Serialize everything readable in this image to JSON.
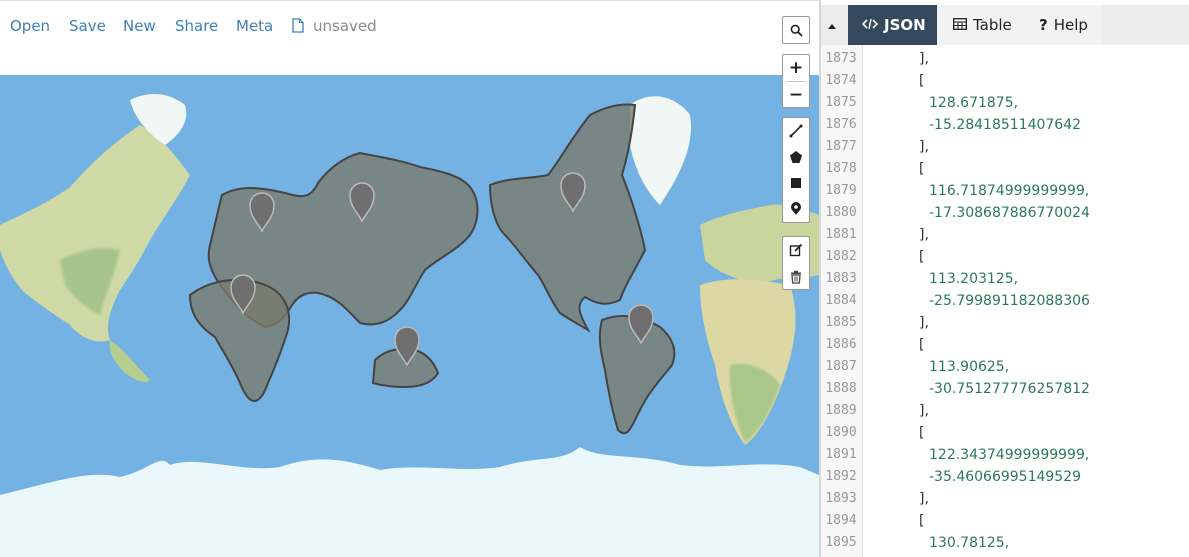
{
  "menu": {
    "items": [
      "Open",
      "Save",
      "New",
      "Share",
      "Meta"
    ],
    "file_status": "unsaved"
  },
  "map_controls": {
    "search_icon": "search-icon",
    "zoom_in": "+",
    "zoom_out": "−",
    "draw_tools": [
      "draw-line-icon",
      "draw-polygon-icon",
      "draw-rectangle-icon",
      "draw-marker-icon"
    ],
    "edit_tools": [
      "edit-layers-icon",
      "delete-layers-icon"
    ]
  },
  "panel": {
    "tabs": [
      {
        "label": "JSON",
        "icon": "code-icon",
        "active": true
      },
      {
        "label": "Table",
        "icon": "table-icon",
        "active": false
      },
      {
        "label": "Help",
        "icon": "help-icon",
        "active": false
      }
    ]
  },
  "editor": {
    "lines": [
      {
        "n": "1873",
        "text": "],",
        "type": "punct"
      },
      {
        "n": "1874",
        "text": "[",
        "type": "punct"
      },
      {
        "n": "1875",
        "text": "128.671875,",
        "type": "num"
      },
      {
        "n": "1876",
        "text": "-15.28418511407642",
        "type": "num"
      },
      {
        "n": "1877",
        "text": "],",
        "type": "punct"
      },
      {
        "n": "1878",
        "text": "[",
        "type": "punct"
      },
      {
        "n": "1879",
        "text": "116.71874999999999,",
        "type": "num"
      },
      {
        "n": "1880",
        "text": "-17.308687886770024",
        "type": "num"
      },
      {
        "n": "1881",
        "text": "],",
        "type": "punct"
      },
      {
        "n": "1882",
        "text": "[",
        "type": "punct"
      },
      {
        "n": "1883",
        "text": "113.203125,",
        "type": "num"
      },
      {
        "n": "1884",
        "text": "-25.799891182088306",
        "type": "num"
      },
      {
        "n": "1885",
        "text": "],",
        "type": "punct"
      },
      {
        "n": "1886",
        "text": "[",
        "type": "punct"
      },
      {
        "n": "1887",
        "text": "113.90625,",
        "type": "num"
      },
      {
        "n": "1888",
        "text": "-30.751277776257812",
        "type": "num"
      },
      {
        "n": "1889",
        "text": "],",
        "type": "punct"
      },
      {
        "n": "1890",
        "text": "[",
        "type": "punct"
      },
      {
        "n": "1891",
        "text": "122.34374999999999,",
        "type": "num"
      },
      {
        "n": "1892",
        "text": "-35.46066995149529",
        "type": "num"
      },
      {
        "n": "1893",
        "text": "],",
        "type": "punct"
      },
      {
        "n": "1894",
        "text": "[",
        "type": "punct"
      },
      {
        "n": "1895",
        "text": "130.78125,",
        "type": "num"
      }
    ]
  },
  "colors": {
    "accent": "#3c80b8",
    "active_tab": "#34495e",
    "ocean": "#73b2e2",
    "polygon_fill": "#7a7a6a",
    "polygon_stroke": "#444444",
    "number": "#2b7a57"
  }
}
